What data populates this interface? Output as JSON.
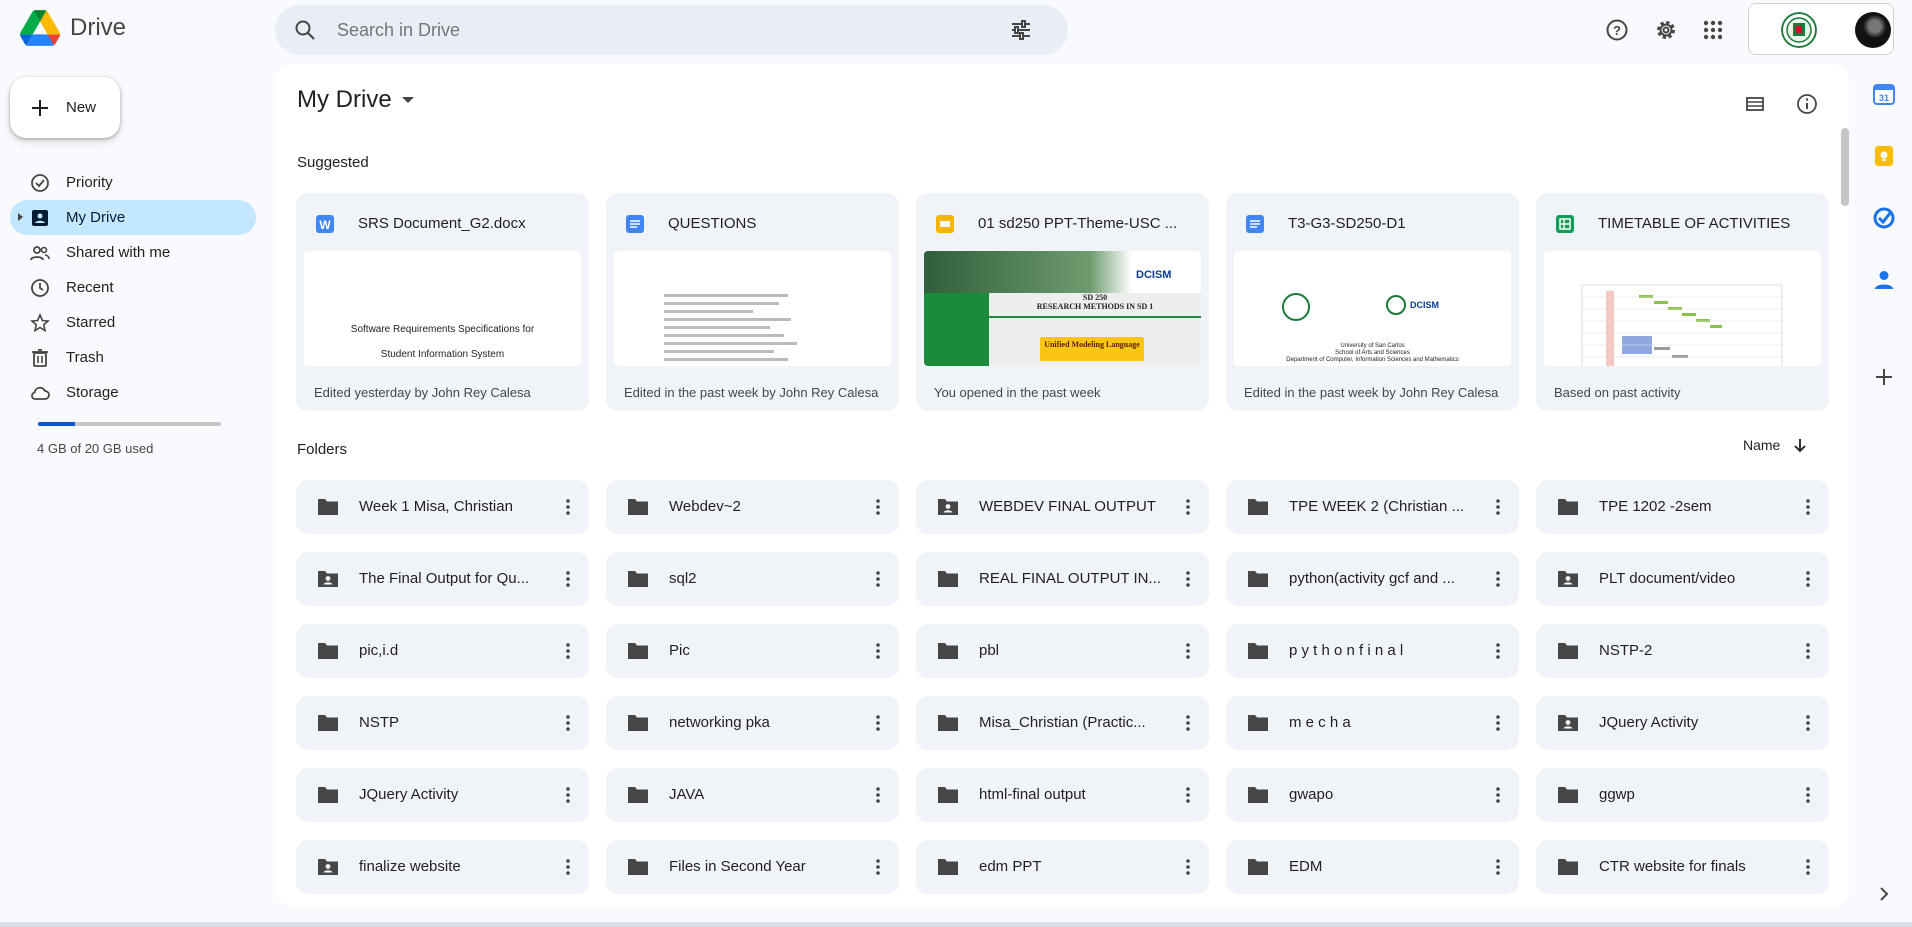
{
  "app": {
    "name": "Drive"
  },
  "search": {
    "placeholder": "Search in Drive"
  },
  "new_button": {
    "label": "New"
  },
  "nav": [
    {
      "label": "Priority",
      "icon": "priority-icon"
    },
    {
      "label": "My Drive",
      "icon": "my-drive-icon",
      "active": true
    },
    {
      "label": "Shared with me",
      "icon": "shared-icon"
    },
    {
      "label": "Recent",
      "icon": "clock-icon"
    },
    {
      "label": "Starred",
      "icon": "star-icon"
    },
    {
      "label": "Trash",
      "icon": "trash-icon"
    },
    {
      "label": "Storage",
      "icon": "cloud-icon"
    }
  ],
  "storage": {
    "text": "4 GB of 20 GB used",
    "used_fraction": 0.2
  },
  "main": {
    "title": "My Drive",
    "suggested_label": "Suggested",
    "folders_label": "Folders",
    "sort_label": "Name"
  },
  "suggested": [
    {
      "name": "SRS Document_G2.docx",
      "type": "word",
      "reason": "Edited yesterday by John Rey Calesa",
      "preview": [
        "Software Requirements Specifications for",
        "Student Information System"
      ]
    },
    {
      "name": "QUESTIONS",
      "type": "doc",
      "reason": "Edited in the past week by John Rey Calesa"
    },
    {
      "name": "01 sd250 PPT-Theme-USC ...",
      "type": "slides",
      "reason": "You opened in the past week",
      "preview": [
        "SD 250",
        "RESEARCH METHODS IN SD 1",
        "Unified Modeling Language",
        "DCISM"
      ]
    },
    {
      "name": "T3-G3-SD250-D1",
      "type": "doc",
      "reason": "Edited in the past week by John Rey Calesa",
      "preview": [
        "University of San Carlos",
        "School of Arts and Sciences",
        "Department of Computer, Information Sciences and Mathematics"
      ]
    },
    {
      "name": "TIMETABLE OF ACTIVITIES",
      "type": "sheets",
      "reason": "Based on past activity"
    }
  ],
  "folders": [
    {
      "name": "Week 1 Misa, Christian",
      "shared": false
    },
    {
      "name": "Webdev~2",
      "shared": false
    },
    {
      "name": "WEBDEV FINAL OUTPUT",
      "shared": true
    },
    {
      "name": "TPE WEEK 2 (Christian ...",
      "shared": false
    },
    {
      "name": "TPE 1202 -2sem",
      "shared": false
    },
    {
      "name": "The Final Output for Qu...",
      "shared": true
    },
    {
      "name": "sql2",
      "shared": false
    },
    {
      "name": "REAL FINAL OUTPUT IN...",
      "shared": false
    },
    {
      "name": "python(activity gcf and ...",
      "shared": false
    },
    {
      "name": "PLT document/video",
      "shared": true
    },
    {
      "name": "pic,i.d",
      "shared": false
    },
    {
      "name": "Pic",
      "shared": false
    },
    {
      "name": "pbl",
      "shared": false
    },
    {
      "name": "p y t h o n f i n a l",
      "shared": false
    },
    {
      "name": "NSTP-2",
      "shared": false
    },
    {
      "name": "NSTP",
      "shared": false
    },
    {
      "name": "networking pka",
      "shared": false
    },
    {
      "name": "Misa_Christian (Practic...",
      "shared": false
    },
    {
      "name": "m e c h a",
      "shared": false
    },
    {
      "name": "JQuery Activity",
      "shared": true
    },
    {
      "name": "JQuery Activity",
      "shared": false
    },
    {
      "name": "JAVA",
      "shared": false
    },
    {
      "name": "html-final output",
      "shared": false
    },
    {
      "name": "gwapo",
      "shared": false
    },
    {
      "name": "ggwp",
      "shared": false
    },
    {
      "name": "finalize website",
      "shared": true
    },
    {
      "name": "Files in Second Year",
      "shared": false
    },
    {
      "name": "edm PPT",
      "shared": false
    },
    {
      "name": "EDM",
      "shared": false
    },
    {
      "name": "CTR website for finals",
      "shared": false
    }
  ],
  "colors": {
    "accent": "#0b57d0",
    "active_nav": "#c2e7ff",
    "card_bg": "#f0f4f9",
    "page_bg": "#f8fafd"
  }
}
